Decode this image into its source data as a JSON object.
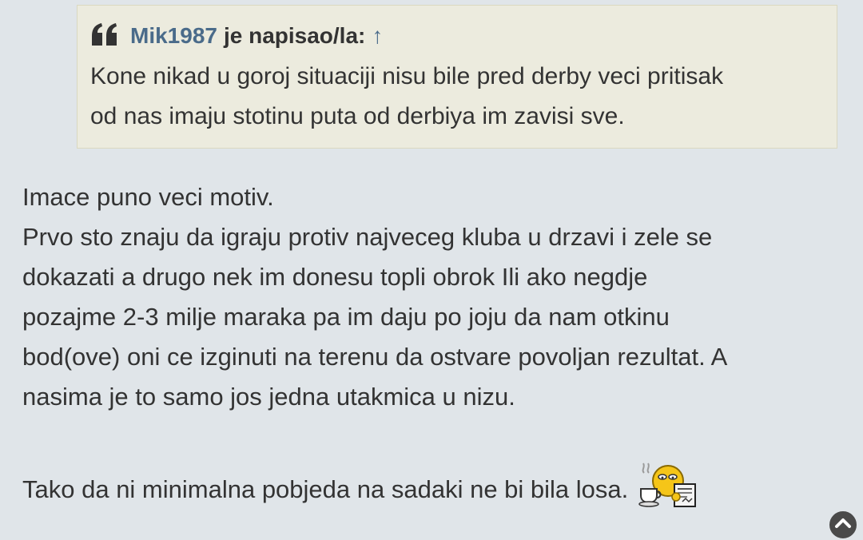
{
  "quote": {
    "icon": "quote-icon",
    "author": "Mik1987",
    "wrote_label": "je napisao/la:",
    "arrow": "↑",
    "lines": [
      "Kone nikad u goroj situaciji nisu bile pred derby veci pritisak",
      "od nas imaju stotinu puta od derbiya im zavisi sve."
    ]
  },
  "post": {
    "lines": [
      "Imace puno veci motiv.",
      "Prvo sto znaju da igraju protiv najveceg kluba u drzavi i zele se",
      "dokazati a drugo nek im donesu topli obrok Ili ako negdje",
      "pozajme 2-3 milje maraka pa im daju po joju da nam otkinu",
      "bod(ove) oni ce izginuti na terenu da ostvare povoljan rezultat. A",
      "nasima je to samo jos jedna utakmica u nizu."
    ],
    "final_line": "Tako da ni minimalna pobjeda na sadaki ne bi bila losa.",
    "smiley": "coffee-newspaper-smiley-icon"
  },
  "scroll_top": {
    "icon": "chevron-up-icon"
  },
  "colors": {
    "background": "#e0e5e9",
    "quote_background": "#ecebde",
    "author_link": "#4a6b8a",
    "text": "#333333"
  }
}
